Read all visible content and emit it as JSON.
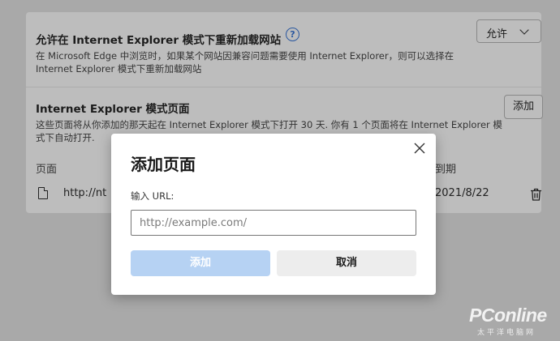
{
  "section_reload": {
    "title": "允许在 Internet Explorer 模式下重新加载网站",
    "help_glyph": "?",
    "description": "在 Microsoft Edge 中浏览时，如果某个网站因兼容问题需要使用 Internet Explorer，则可以选择在 Internet Explorer 模式下重新加载网站",
    "select_value": "允许"
  },
  "section_pages": {
    "title": "Internet Explorer 模式页面",
    "description": "这些页面将从你添加的那天起在 Internet Explorer 模式下打开 30 天. 你有 1 个页面将在 Internet Explorer 模式下自动打开.",
    "add_button": "添加",
    "col_page": "页面",
    "col_expiry": "到期",
    "row": {
      "url": "http://nt",
      "date": "2021/8/22"
    }
  },
  "dialog": {
    "title": "添加页面",
    "url_label": "输入 URL:",
    "url_placeholder": "http://example.com/",
    "url_value": "",
    "add_label": "添加",
    "cancel_label": "取消"
  },
  "watermark": {
    "brand": "PConline",
    "sub": "太平洋电脑网"
  },
  "colors": {
    "overlay_bg": "#a9a9a9",
    "primary_disabled": "#b6d2f3",
    "secondary_button": "#ededed"
  }
}
